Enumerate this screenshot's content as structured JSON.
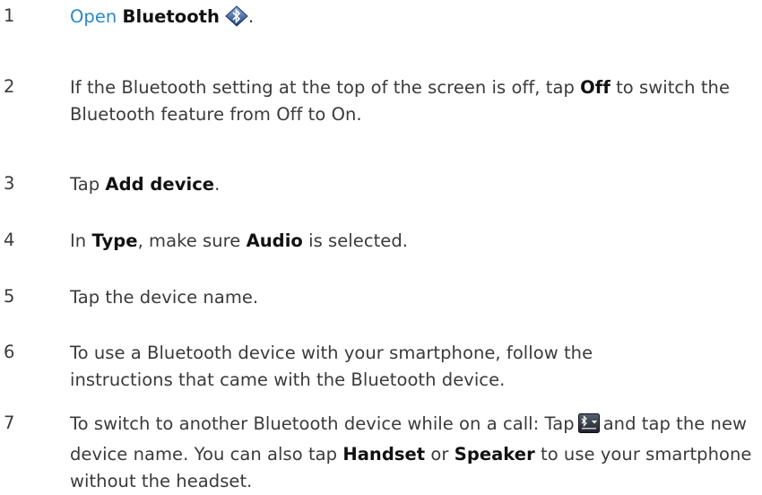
{
  "steps": [
    {
      "num": "1",
      "open_label": "Open",
      "target": "Bluetooth",
      "suffix": ".",
      "icon": "bluetooth-icon"
    },
    {
      "num": "2",
      "text_a": "If the Bluetooth setting at the top of the screen is off, tap",
      "bold": "Off",
      "text_b": "to switch the Bluetooth feature from Off to On."
    },
    {
      "num": "3",
      "text_a": "Tap",
      "bold": "Add device",
      "text_b": "."
    },
    {
      "num": "4",
      "text_a": "In",
      "bold1": "Type",
      "text_b": ", make sure",
      "bold2": "Audio",
      "text_c": "is selected."
    },
    {
      "num": "5",
      "text": "Tap the device name."
    },
    {
      "num": "6",
      "text": "To use a Bluetooth device with your smartphone, follow the instructions that came with the Bluetooth device."
    },
    {
      "num": "7",
      "text_a": "To switch to another Bluetooth device while on a call: Tap",
      "icon": "audio-source-icon",
      "text_b": "and tap the new device name. You can also tap",
      "bold1": "Handset",
      "text_c": "or",
      "bold2": "Speaker",
      "text_d": "to use your smartphone without the headset."
    }
  ]
}
